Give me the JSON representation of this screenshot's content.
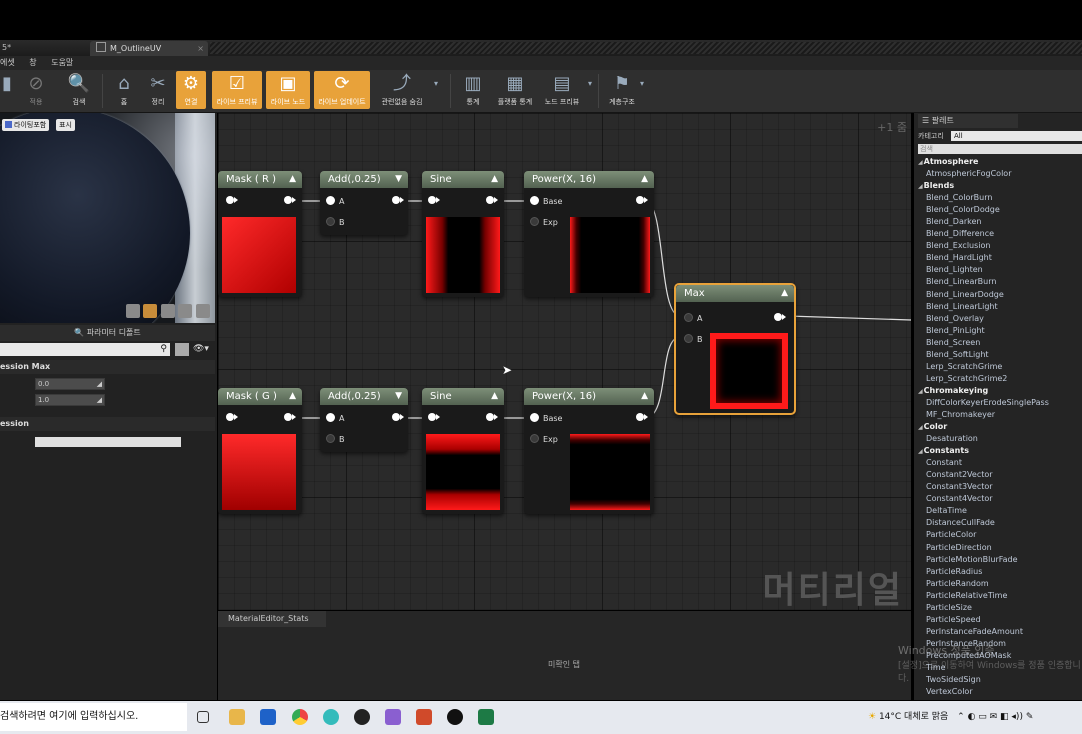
{
  "window": {
    "tab_prev": "5*",
    "tab_active": "M_OutlineUV",
    "tab_close": "×"
  },
  "menu": [
    "에셋",
    "창",
    "도움말"
  ],
  "toolbar": {
    "buttons": [
      {
        "label": "적용",
        "icon": "apply-icon"
      },
      {
        "label": "검색",
        "icon": "browse-icon"
      },
      {
        "label": "홈",
        "icon": "home-icon"
      },
      {
        "label": "정리",
        "icon": "clean-up-icon"
      },
      {
        "label": "연결",
        "icon": "connectors-icon"
      },
      {
        "label": "라이브 프리뷰",
        "icon": "live-preview-icon"
      },
      {
        "label": "라이브 노드",
        "icon": "live-nodes-icon"
      },
      {
        "label": "라이브 업데이트",
        "icon": "live-update-icon"
      },
      {
        "label": "관련없음 숨김",
        "icon": "hide-unrelated-icon"
      },
      {
        "label": "통계",
        "icon": "stats-icon"
      },
      {
        "label": "플랫폼 통계",
        "icon": "platform-stats-icon"
      },
      {
        "label": "노드 프리뷰",
        "icon": "node-preview-icon"
      },
      {
        "label": "계층구조",
        "icon": "hierarchy-icon"
      }
    ]
  },
  "preview": {
    "lighting_button": "라이팅포함",
    "show_button": "표시"
  },
  "details": {
    "title": "파라미터 디폴트",
    "section1": "ession Max",
    "field1": "0.0",
    "field2": "1.0",
    "section2": "ession"
  },
  "graph": {
    "zoom": "+1 줌",
    "watermark": "머티리얼",
    "nodes": {
      "mask_r": {
        "title": "Mask ( R )"
      },
      "add1": {
        "title": "Add(,0.25)",
        "pin_a": "A",
        "pin_b": "B"
      },
      "sine1": {
        "title": "Sine"
      },
      "power1": {
        "title": "Power(X, 16)",
        "pin_base": "Base",
        "pin_exp": "Exp"
      },
      "max": {
        "title": "Max",
        "pin_a": "A",
        "pin_b": "B"
      },
      "mask_g": {
        "title": "Mask ( G )"
      },
      "add2": {
        "title": "Add(,0.25)",
        "pin_a": "A",
        "pin_b": "B"
      },
      "sine2": {
        "title": "Sine"
      },
      "power2": {
        "title": "Power(X, 16)",
        "pin_base": "Base",
        "pin_exp": "Exp"
      }
    }
  },
  "stats": {
    "tab": "MaterialEditor_Stats",
    "message": "미확인 탭"
  },
  "palette": {
    "tab": "팔레트",
    "category_label": "카테고리",
    "category_value": "All",
    "search_placeholder": "검색",
    "items": [
      {
        "kind": "cat",
        "text": "Atmosphere"
      },
      {
        "kind": "item",
        "text": "AtmosphericFogColor"
      },
      {
        "kind": "cat",
        "text": "Blends"
      },
      {
        "kind": "item",
        "text": "Blend_ColorBurn"
      },
      {
        "kind": "item",
        "text": "Blend_ColorDodge"
      },
      {
        "kind": "item",
        "text": "Blend_Darken"
      },
      {
        "kind": "item",
        "text": "Blend_Difference"
      },
      {
        "kind": "item",
        "text": "Blend_Exclusion"
      },
      {
        "kind": "item",
        "text": "Blend_HardLight"
      },
      {
        "kind": "item",
        "text": "Blend_Lighten"
      },
      {
        "kind": "item",
        "text": "Blend_LinearBurn"
      },
      {
        "kind": "item",
        "text": "Blend_LinearDodge"
      },
      {
        "kind": "item",
        "text": "Blend_LinearLight"
      },
      {
        "kind": "item",
        "text": "Blend_Overlay"
      },
      {
        "kind": "item",
        "text": "Blend_PinLight"
      },
      {
        "kind": "item",
        "text": "Blend_Screen"
      },
      {
        "kind": "item",
        "text": "Blend_SoftLight"
      },
      {
        "kind": "item",
        "text": "Lerp_ScratchGrime"
      },
      {
        "kind": "item",
        "text": "Lerp_ScratchGrime2"
      },
      {
        "kind": "cat",
        "text": "Chromakeying"
      },
      {
        "kind": "item",
        "text": "DiffColorKeyerErodeSinglePass"
      },
      {
        "kind": "item",
        "text": "MF_Chromakeyer"
      },
      {
        "kind": "cat",
        "text": "Color"
      },
      {
        "kind": "item",
        "text": "Desaturation"
      },
      {
        "kind": "cat",
        "text": "Constants"
      },
      {
        "kind": "item",
        "text": "Constant"
      },
      {
        "kind": "item",
        "text": "Constant2Vector"
      },
      {
        "kind": "item",
        "text": "Constant3Vector"
      },
      {
        "kind": "item",
        "text": "Constant4Vector"
      },
      {
        "kind": "item",
        "text": "DeltaTime"
      },
      {
        "kind": "item",
        "text": "DistanceCullFade"
      },
      {
        "kind": "item",
        "text": "ParticleColor"
      },
      {
        "kind": "item",
        "text": "ParticleDirection"
      },
      {
        "kind": "item",
        "text": "ParticleMotionBlurFade"
      },
      {
        "kind": "item",
        "text": "ParticleRadius"
      },
      {
        "kind": "item",
        "text": "ParticleRandom"
      },
      {
        "kind": "item",
        "text": "ParticleRelativeTime"
      },
      {
        "kind": "item",
        "text": "ParticleSize"
      },
      {
        "kind": "item",
        "text": "ParticleSpeed"
      },
      {
        "kind": "item",
        "text": "PerInstanceFadeAmount"
      },
      {
        "kind": "item",
        "text": "PerInstanceRandom"
      },
      {
        "kind": "item",
        "text": "PrecomputedAOMask"
      },
      {
        "kind": "item",
        "text": "Time"
      },
      {
        "kind": "item",
        "text": "TwoSidedSign"
      },
      {
        "kind": "item",
        "text": "VertexColor"
      }
    ]
  },
  "activation": {
    "line1": "Windows 정품 인증",
    "line2": "[설정]으로 이동하여 Windows를 정품 인증합니다."
  },
  "taskbar": {
    "search_placeholder": "검색하려면 여기에 입력하십시오.",
    "weather": "14°C 대체로 맑음"
  },
  "colors": {
    "accent": "#e8a23a",
    "node_header": "#6b7c67",
    "preview_red": "#ff1a1a"
  }
}
